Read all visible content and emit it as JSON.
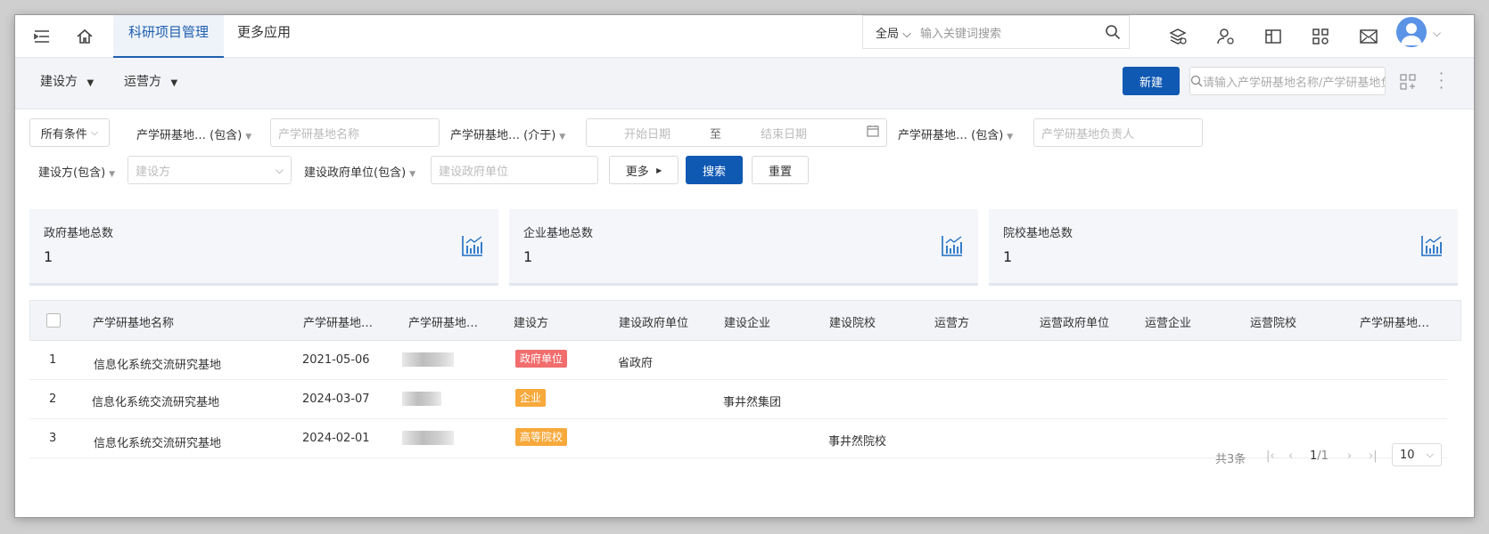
{
  "topbar": {
    "tabs": [
      {
        "label": "科研项目管理",
        "active": true
      },
      {
        "label": "更多应用",
        "active": false
      }
    ],
    "search": {
      "scope": "全局",
      "placeholder": "输入关键词搜索"
    },
    "icons": [
      "menu-icon",
      "home-icon",
      "layers-icon",
      "user-settings-icon",
      "layout-icon",
      "grid-settings-icon",
      "mail-icon"
    ]
  },
  "subbar": {
    "dropdowns": [
      "建设方",
      "运营方"
    ],
    "new_label": "新建",
    "search_placeholder": "请输入产学研基地名称/产学研基地负责人"
  },
  "filters": {
    "all_conditions": "所有条件",
    "row1": [
      {
        "label": "产学研基地… (包含)",
        "placeholder": "产学研基地名称"
      },
      {
        "label": "产学研基地… (介于)",
        "start": "开始日期",
        "sep": "至",
        "end": "结束日期"
      },
      {
        "label": "产学研基地… (包含)",
        "placeholder": "产学研基地负责人"
      }
    ],
    "row2": [
      {
        "label": "建设方(包含)",
        "placeholder": "建设方"
      },
      {
        "label": "建设政府单位(包含)",
        "placeholder": "建设政府单位"
      }
    ],
    "more_label": "更多",
    "search_label": "搜索",
    "reset_label": "重置"
  },
  "stats": [
    {
      "label": "政府基地总数",
      "value": "1"
    },
    {
      "label": "企业基地总数",
      "value": "1"
    },
    {
      "label": "院校基地总数",
      "value": "1"
    }
  ],
  "table": {
    "columns": [
      "产学研基地名称",
      "产学研基地…",
      "产学研基地…",
      "建设方",
      "建设政府单位",
      "建设企业",
      "建设院校",
      "运营方",
      "运营政府单位",
      "运营企业",
      "运营院校",
      "产学研基地…"
    ],
    "rows": [
      {
        "index": "1",
        "name": "信息化系统交流研究基地",
        "date": "2021-05-06",
        "builder": "政府单位",
        "builder_color": "#f26d6d",
        "gov": "省政府",
        "enterprise": "",
        "college": ""
      },
      {
        "index": "2",
        "name": "信息化系统交流研究基地",
        "date": "2024-03-07",
        "builder": "企业",
        "builder_color": "#f7a93b",
        "gov": "",
        "enterprise": "事井然集团",
        "college": ""
      },
      {
        "index": "3",
        "name": "信息化系统交流研究基地",
        "date": "2024-02-01",
        "builder": "高等院校",
        "builder_color": "#f7a93b",
        "gov": "",
        "enterprise": "",
        "college": "事井然院校"
      }
    ]
  },
  "pagination": {
    "total": "共3条",
    "page": "1",
    "pages": "/1",
    "page_size": "10"
  }
}
